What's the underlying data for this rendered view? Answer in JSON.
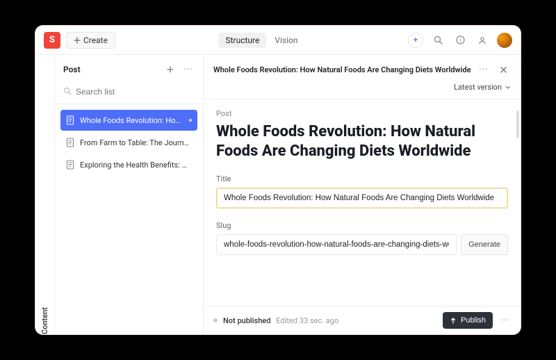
{
  "topbar": {
    "logo_letter": "S",
    "create_label": "Create"
  },
  "tabs": {
    "structure": "Structure",
    "vision": "Vision"
  },
  "rail": {
    "label": "Content"
  },
  "listpane": {
    "title": "Post",
    "search_placeholder": "Search list",
    "items": [
      {
        "label": "Whole Foods Revolution: How N…"
      },
      {
        "label": "From Farm to Table: The Journey …"
      },
      {
        "label": "Exploring the Health Benefits: A D…"
      }
    ]
  },
  "mainhead": {
    "title": "Whole Foods Revolution: How Natural Foods Are Changing Diets Worldwide",
    "version_label": "Latest version"
  },
  "content": {
    "eyebrow": "Post",
    "heading": "Whole Foods Revolution: How Natural Foods Are Changing Diets Worldwide",
    "title_label": "Title",
    "title_value": "Whole Foods Revolution: How Natural Foods Are Changing Diets Worldwide",
    "slug_label": "Slug",
    "slug_value": "whole-foods-revolution-how-natural-foods-are-changing-diets-wor",
    "generate_label": "Generate"
  },
  "footer": {
    "status": "Not published",
    "edited": "Edited 33 sec. ago",
    "publish_label": "Publish"
  }
}
